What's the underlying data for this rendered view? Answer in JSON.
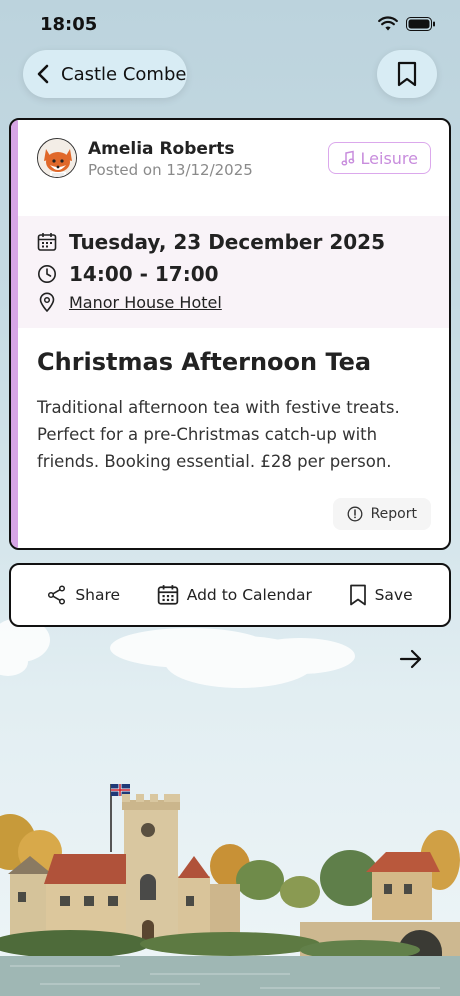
{
  "status_bar": {
    "time": "18:05"
  },
  "nav": {
    "back_label": "Castle Combe"
  },
  "post": {
    "author_name": "Amelia Roberts",
    "posted_text": "Posted on 13/12/2025",
    "tag_label": "Leisure",
    "date": "Tuesday, 23 December 2025",
    "time": "14:00 - 17:00",
    "location": "Manor House Hotel",
    "title": "Christmas Afternoon Tea",
    "description": "Traditional afternoon tea with festive treats. Perfect for a pre-Christmas catch-up with friends. Booking essential. £28 per person.",
    "report_label": "Report"
  },
  "actions": {
    "share_label": "Share",
    "calendar_label": "Add to Calendar",
    "save_label": "Save"
  },
  "icons": {
    "back": "chevron-left-icon",
    "bookmark": "bookmark-icon",
    "tag": "music-note-icon",
    "date": "calendar-icon",
    "time": "clock-icon",
    "location": "map-pin-icon",
    "report": "alert-circle-icon",
    "share": "share-icon",
    "calendar": "calendar-icon",
    "save": "bookmark-icon",
    "next": "arrow-right-icon"
  },
  "colors": {
    "accent": "#d7a6e6",
    "tag_text": "#c88ddd",
    "nav_pill": "#d8ecf4",
    "details_bg": "#f9f3f8"
  }
}
